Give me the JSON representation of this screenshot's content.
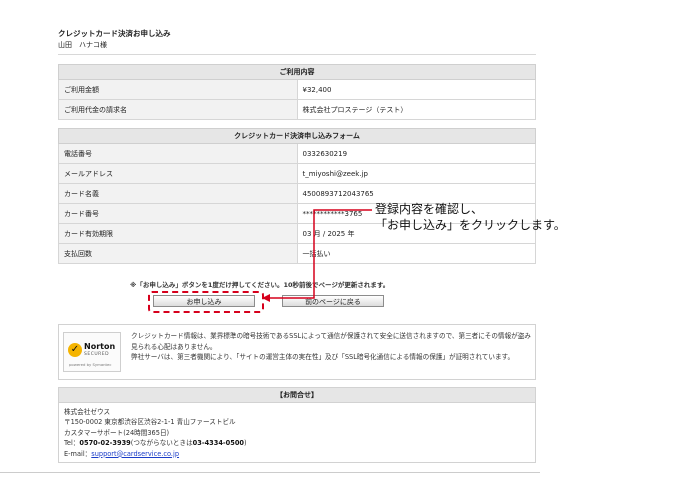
{
  "header": {
    "title": "クレジットカード決済お申し込み",
    "customer_name": "山田　ハナコ様"
  },
  "usage": {
    "caption": "ご利用内容",
    "rows": [
      {
        "label": "ご利用金額",
        "value": "¥32,400"
      },
      {
        "label": "ご利用代金の請求名",
        "value": "株式会社プロステージ（テスト）"
      }
    ]
  },
  "card_form": {
    "caption": "クレジットカード決済申し込みフォーム",
    "rows": [
      {
        "label": "電話番号",
        "value": "0332630219"
      },
      {
        "label": "メールアドレス",
        "value": "t_miyoshi@zeek.jp"
      },
      {
        "label": "カード名義",
        "value": "4500893712043765"
      },
      {
        "label": "カード番号",
        "value": "************3765"
      },
      {
        "label": "カード有効期限",
        "value": "03 月 / 2025 年"
      },
      {
        "label": "支払回数",
        "value": "一括払い"
      }
    ]
  },
  "notice": "※「お申し込み」ボタンを1度だけ押してください。10秒前後でページが更新されます。",
  "buttons": {
    "submit": "お申し込み",
    "back": "前のページに戻る"
  },
  "callout": {
    "line1": "登録内容を確認し、",
    "line2": "「お申し込み」をクリックします。"
  },
  "security": {
    "badge_title": "Norton",
    "badge_sub": "SECURED",
    "badge_by": "powered by Symantec",
    "line1": "クレジットカード情報は、業界標準の暗号技術であるSSLによって通信が保護されて安全に送信されますので、第三者にその情報が盗み見られる心配はありません。",
    "line2": "弊社サーバは、第三者機関により、「サイトの運営主体の実在性」及び「SSL暗号化通信による情報の保護」が証明されています。"
  },
  "inquiry": {
    "caption": "【お問合せ】",
    "company": "株式会社ゼウス",
    "address": "〒150-0002 東京都渋谷区渋谷2-1-1 青山ファーストビル",
    "support": "カスタマーサポート(24時間365日)",
    "tel_label": "Tel：",
    "tel_main": "0570-02-3939",
    "tel_note": "(つながらないときは",
    "tel_alt": "03-4334-0500",
    "tel_close": ")",
    "email_label": "E-mail：",
    "email": "support@cardservice.co.jp"
  },
  "colors": {
    "accent_red": "#d6001c",
    "link_blue": "#1a3cc8",
    "header_gray": "#e6e6e6"
  }
}
